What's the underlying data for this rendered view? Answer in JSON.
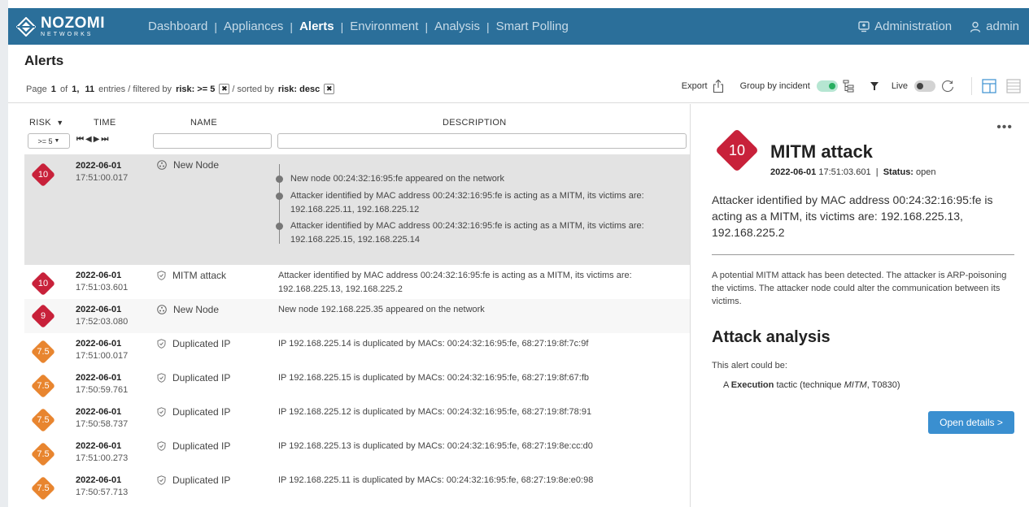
{
  "nav": {
    "logo_main": "NOZOMI",
    "logo_sub": "NETWORKS",
    "items": [
      "Dashboard",
      "Appliances",
      "Alerts",
      "Environment",
      "Analysis",
      "Smart Polling"
    ],
    "admin_link": "Administration",
    "user": "admin"
  },
  "header": {
    "title": "Alerts",
    "page_prefix": "Page",
    "page_current": "1",
    "page_of": "of",
    "page_total": "1,",
    "entries_count": "11",
    "entries_text": "entries / filtered by",
    "filter_label": "risk: >= 5",
    "sorted_text": "/ sorted by",
    "sort_label": "risk: desc",
    "export": "Export",
    "group_by": "Group by incident",
    "live": "Live"
  },
  "columns": {
    "risk": "RISK",
    "time": "TIME",
    "name": "NAME",
    "description": "DESCRIPTION",
    "risk_filter": ">= 5"
  },
  "alerts": [
    {
      "risk": "10",
      "date": "2022-06-01",
      "time": "17:51:00.017",
      "name": "New Node",
      "icon": "node-icon",
      "desc": "",
      "timeline": [
        "New node 00:24:32:16:95:fe appeared on the network",
        "Attacker identified by MAC address 00:24:32:16:95:fe is acting as a MITM, its victims are: 192.168.225.11, 192.168.225.12",
        "Attacker identified by MAC address 00:24:32:16:95:fe is acting as a MITM, its victims are: 192.168.225.15, 192.168.225.14"
      ]
    },
    {
      "risk": "10",
      "date": "2022-06-01",
      "time": "17:51:03.601",
      "name": "MITM attack",
      "icon": "shield-icon",
      "desc": "Attacker identified by MAC address 00:24:32:16:95:fe is acting as a MITM, its victims are: 192.168.225.13, 192.168.225.2"
    },
    {
      "risk": "9",
      "date": "2022-06-01",
      "time": "17:52:03.080",
      "name": "New Node",
      "icon": "node-icon",
      "desc": "New node 192.168.225.35 appeared on the network"
    },
    {
      "risk": "7.5",
      "date": "2022-06-01",
      "time": "17:51:00.017",
      "name": "Duplicated IP",
      "icon": "shield-icon",
      "desc": "IP 192.168.225.14 is duplicated by MACs: 00:24:32:16:95:fe, 68:27:19:8f:7c:9f"
    },
    {
      "risk": "7.5",
      "date": "2022-06-01",
      "time": "17:50:59.761",
      "name": "Duplicated IP",
      "icon": "shield-icon",
      "desc": "IP 192.168.225.15 is duplicated by MACs: 00:24:32:16:95:fe, 68:27:19:8f:67:fb"
    },
    {
      "risk": "7.5",
      "date": "2022-06-01",
      "time": "17:50:58.737",
      "name": "Duplicated IP",
      "icon": "shield-icon",
      "desc": "IP 192.168.225.12 is duplicated by MACs: 00:24:32:16:95:fe, 68:27:19:8f:78:91"
    },
    {
      "risk": "7.5",
      "date": "2022-06-01",
      "time": "17:51:00.273",
      "name": "Duplicated IP",
      "icon": "shield-icon",
      "desc": "IP 192.168.225.13 is duplicated by MACs: 00:24:32:16:95:fe, 68:27:19:8e:cc:d0"
    },
    {
      "risk": "7.5",
      "date": "2022-06-01",
      "time": "17:50:57.713",
      "name": "Duplicated IP",
      "icon": "shield-icon",
      "desc": "IP 192.168.225.11 is duplicated by MACs: 00:24:32:16:95:fe, 68:27:19:8e:e0:98"
    }
  ],
  "detail": {
    "risk": "10",
    "title": "MITM attack",
    "date": "2022-06-01",
    "time": "17:51:03.601",
    "sep": "|",
    "status_label": "Status:",
    "status": "open",
    "description": "Attacker identified by MAC address 00:24:32:16:95:fe is acting as a MITM, its victims are: 192.168.225.13, 192.168.225.2",
    "body": "A potential MITM attack has been detected. The attacker is ARP-poisoning the victims. The attacker node could alter the communication between its victims.",
    "analysis_heading": "Attack analysis",
    "could_be": "This alert could be:",
    "tactic_prefix": "A",
    "tactic": "Execution",
    "tactic_mid": "tactic (technique",
    "technique": "MITM",
    "technique_id": ", T0830)",
    "open_details": "Open details >"
  },
  "colors": {
    "navbar": "#2b6f9a",
    "risk_high": "#c8213a",
    "risk_medium": "#e8852f",
    "button": "#3a8fd0",
    "selected_row": "#e3e3e3"
  }
}
